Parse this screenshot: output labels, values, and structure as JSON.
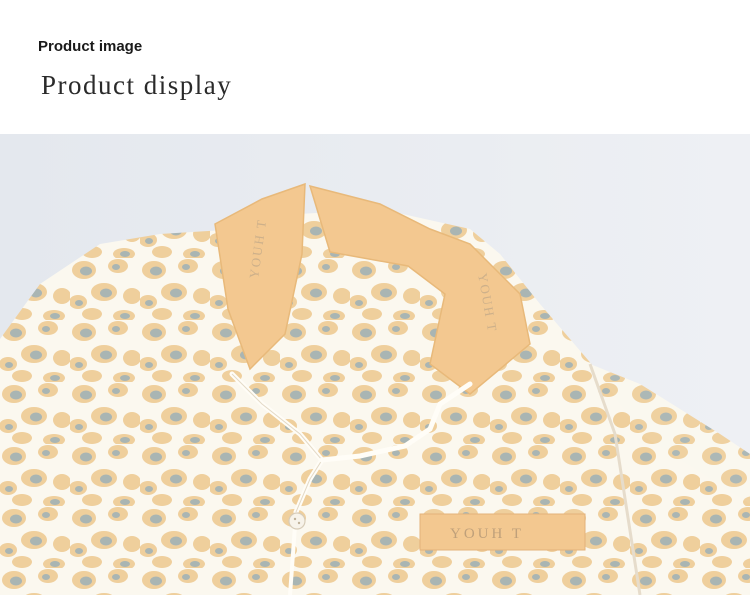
{
  "header": {
    "label_small": "Product image",
    "label_large": "Product display"
  },
  "photo": {
    "subject": "pajama-shirt",
    "embroidery_text": "YOUH T",
    "colors": {
      "background": "#e9edf2",
      "fabric": "#fbf8ef",
      "collar": "#f3c890",
      "spot_tan": "#efcf9c",
      "spot_gray": "#a9b5b3",
      "piping": "#fffdf7"
    }
  }
}
